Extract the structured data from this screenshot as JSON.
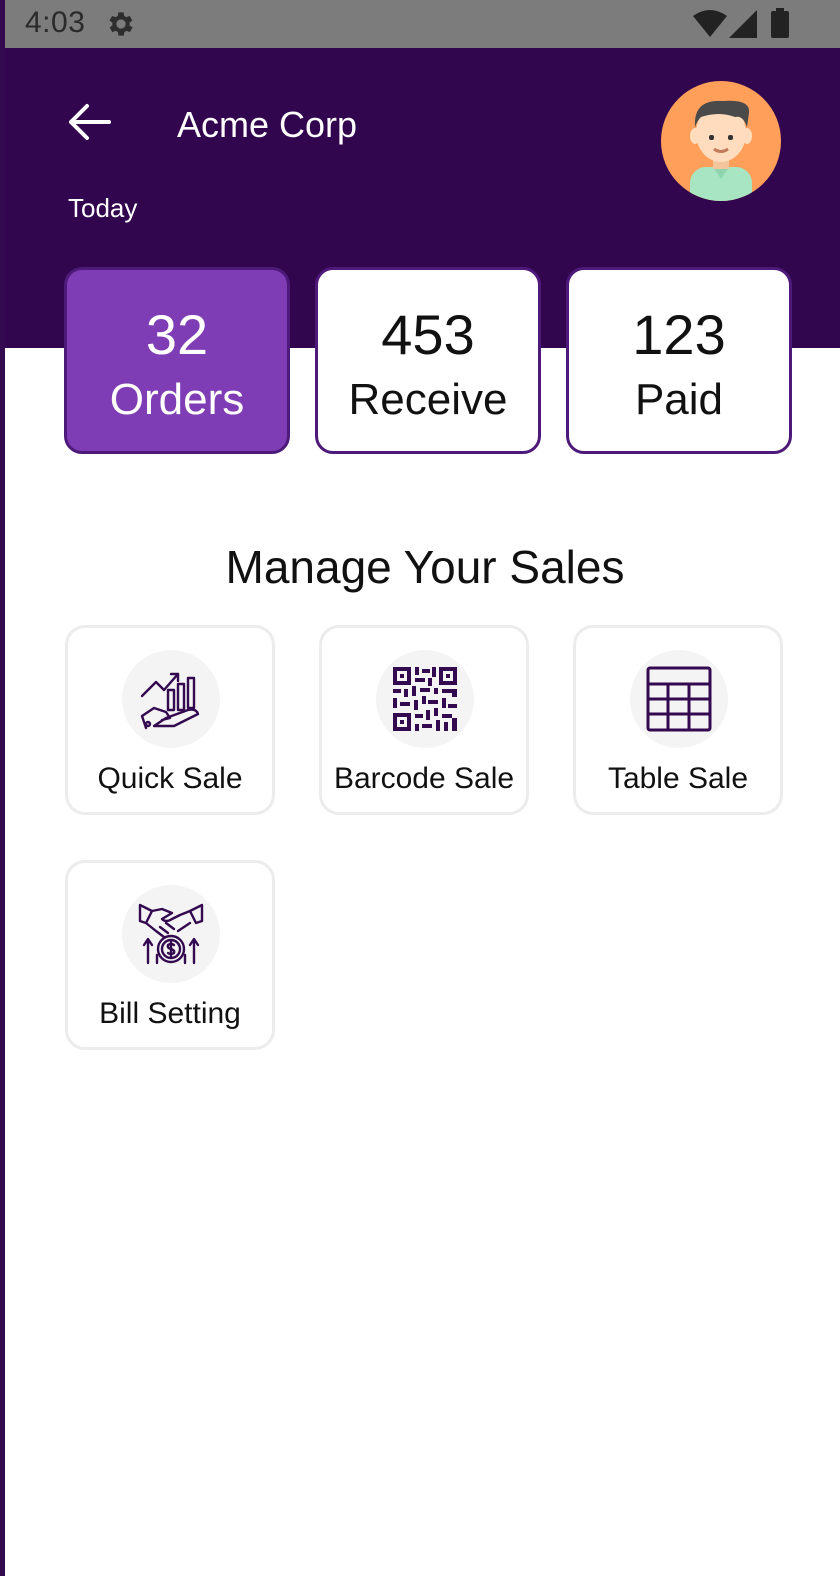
{
  "status_bar": {
    "time": "4:03"
  },
  "header": {
    "title": "Acme Corp",
    "subtitle": "Today"
  },
  "stats": [
    {
      "value": "32",
      "label": "Orders",
      "active": true
    },
    {
      "value": "453",
      "label": "Receive",
      "active": false
    },
    {
      "value": "123",
      "label": "Paid",
      "active": false
    }
  ],
  "section": {
    "title": "Manage Your Sales"
  },
  "tiles": [
    {
      "label": "Quick Sale",
      "icon": "hand-growth-chart-icon"
    },
    {
      "label": "Barcode Sale",
      "icon": "qr-code-icon"
    },
    {
      "label": "Table Sale",
      "icon": "table-grid-icon"
    },
    {
      "label": "Bill Setting",
      "icon": "handshake-dollar-icon"
    }
  ],
  "colors": {
    "header_bg": "#31064e",
    "accent": "#7f3db5",
    "card_border": "#4e1a7a",
    "icon_color": "#33094f"
  }
}
